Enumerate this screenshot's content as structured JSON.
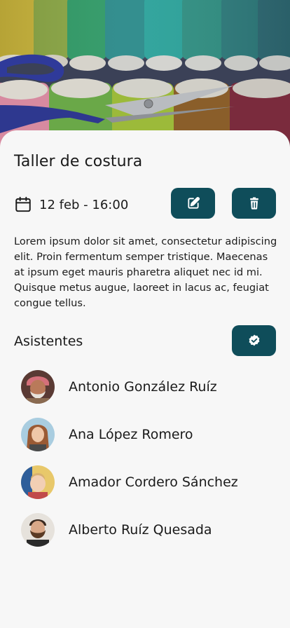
{
  "event": {
    "title": "Taller de costura",
    "datetime": "12 feb - 16:00",
    "description": "Lorem ipsum dolor sit amet, consectetur adipiscing elit. Proin fermentum semper tristique. Maecenas at ipsum eget mauris pharetra aliquet nec id mi. Quisque metus augue, laoreet in lacus ac, feugiat congue tellus."
  },
  "icons": {
    "date": "calendar-icon",
    "edit": "edit-icon",
    "delete": "trash-icon",
    "confirm": "check-badge-icon"
  },
  "colors": {
    "accent": "#0f4d5a",
    "background": "#f7f7f7"
  },
  "attendees_section": {
    "title": "Asistentes",
    "items": [
      {
        "name": "Antonio González Ruíz"
      },
      {
        "name": "Ana López Romero"
      },
      {
        "name": "Amador Cordero Sánchez"
      },
      {
        "name": "Alberto Ruíz Quesada"
      }
    ]
  }
}
